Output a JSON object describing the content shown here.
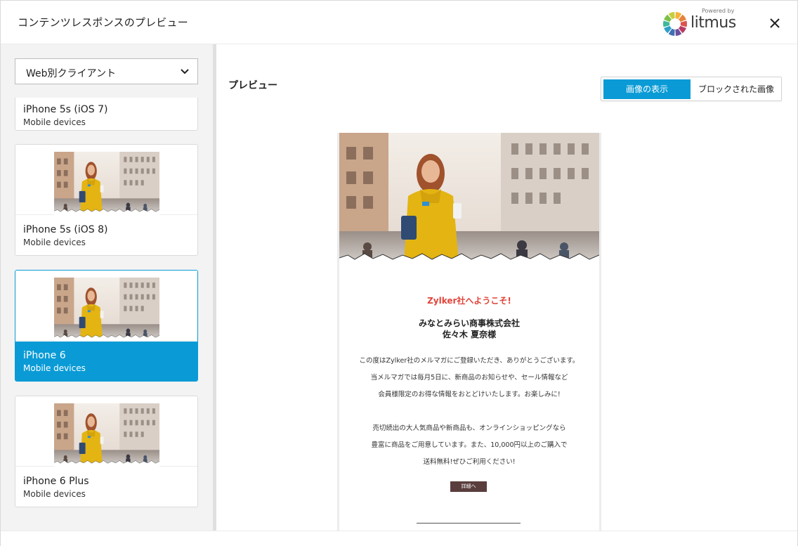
{
  "dialog": {
    "title": "コンテンツレスポンスのプレビュー",
    "brand": {
      "powered_by": "Powered by",
      "name": "litmus",
      "wheel_colors": [
        "#f4b23c",
        "#e8823a",
        "#d9534f",
        "#b93a63",
        "#6b4e9a",
        "#3f6fb5",
        "#2ea0c7",
        "#3fb89a",
        "#7cc04a",
        "#c5cf3d"
      ]
    }
  },
  "sidebar": {
    "client_select": {
      "selected": "Web別クライアント"
    },
    "devices": [
      {
        "name": "iPhone 5s (iOS 7)",
        "category": "Mobile devices"
      },
      {
        "name": "iPhone 5s (iOS 8)",
        "category": "Mobile devices"
      },
      {
        "name": "iPhone 6",
        "category": "Mobile devices",
        "selected": true
      },
      {
        "name": "iPhone 6 Plus",
        "category": "Mobile devices"
      }
    ]
  },
  "main": {
    "preview_label": "プレビュー",
    "image_toggle": {
      "show_images": "画像の表示",
      "blocked_images": "ブロックされた画像",
      "active": "show_images"
    },
    "email": {
      "welcome": "Zylker社へようこそ!",
      "company": "みなとみらい商事株式会社",
      "recipient": "佐々木 夏奈様",
      "paragraph1": [
        "この度はZylker社のメルマガにご登録いただき、ありがとうございます。",
        "当メルマガでは毎月5日に、新商品のお知らせや、セール情報など",
        "会員様限定のお得な情報をおとどけいたします。お楽しみに!"
      ],
      "paragraph2": [
        "売切続出の大人気商品や新商品も、オンラインショッピングなら",
        "豊富に商品をご用意しています。また、10,000円以上のご購入で",
        "送料無料!ぜひご利用ください!"
      ],
      "cta": "詳細へ",
      "accent_color": "#e0453a",
      "cta_color": "#5a3e3d"
    }
  },
  "colors": {
    "primary": "#0a9bd6"
  }
}
